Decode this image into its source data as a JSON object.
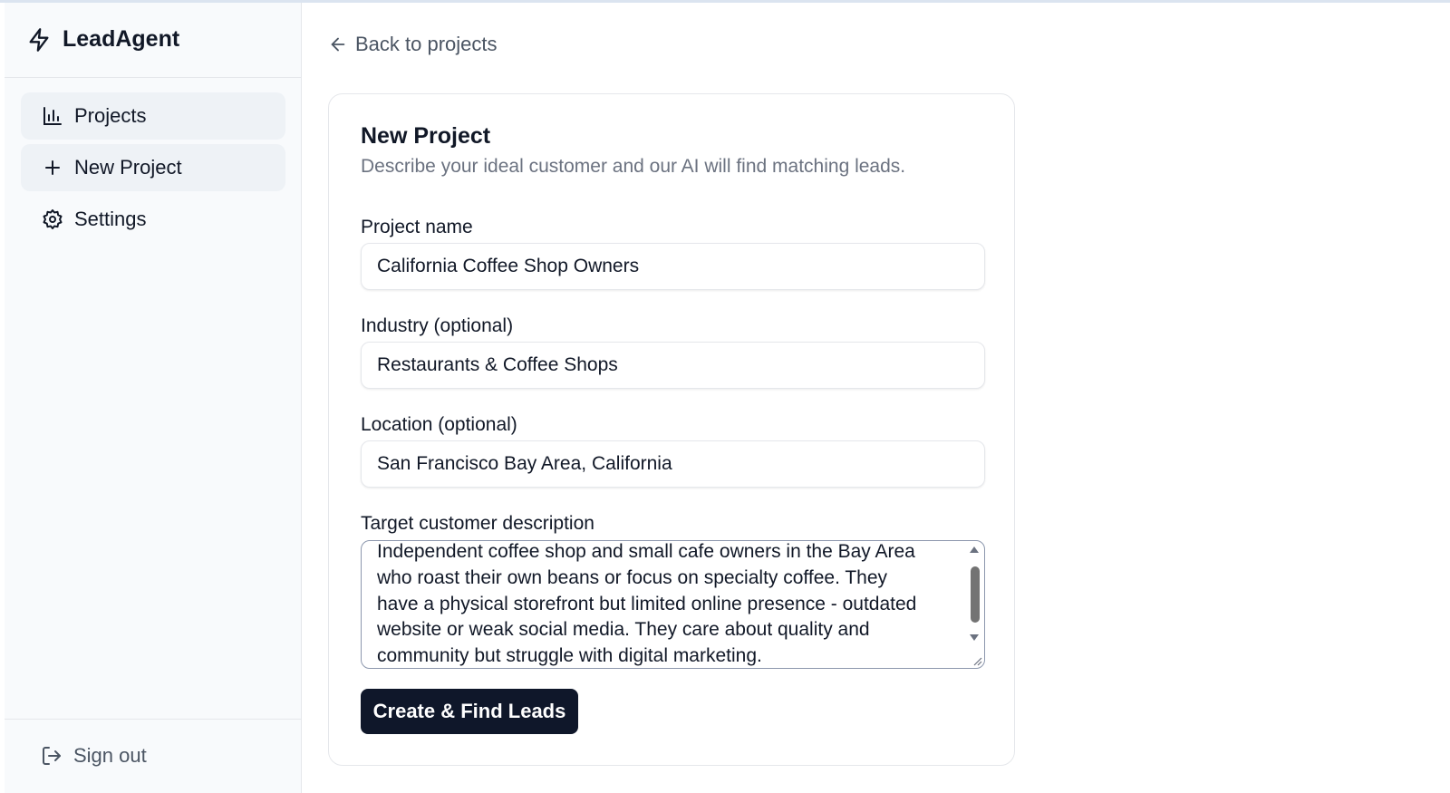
{
  "brand": {
    "name": "LeadAgent",
    "icon": "bolt-icon"
  },
  "sidebar": {
    "items": [
      {
        "label": "Projects",
        "icon": "bar-chart-icon",
        "active": true
      },
      {
        "label": "New Project",
        "icon": "plus-icon",
        "active": true
      },
      {
        "label": "Settings",
        "icon": "gear-icon",
        "active": false
      }
    ],
    "signout_label": "Sign out"
  },
  "main": {
    "back_label": "Back to projects",
    "card": {
      "title": "New Project",
      "subtitle": "Describe your ideal customer and our AI will find matching leads.",
      "fields": {
        "project_name": {
          "label": "Project name",
          "value": "California Coffee Shop Owners"
        },
        "industry": {
          "label": "Industry (optional)",
          "value": "Restaurants & Coffee Shops"
        },
        "location": {
          "label": "Location (optional)",
          "value": "San Francisco Bay Area, California"
        },
        "description": {
          "label": "Target customer description",
          "lines": [
            "Independent coffee shop and small cafe owners in the Bay Area",
            "who roast their own beans or focus on specialty coffee. They",
            "have a physical storefront but limited online presence - outdated",
            "website or weak social media. They care about quality and",
            "community but struggle with digital marketing."
          ]
        }
      },
      "submit_label": "Create & Find Leads"
    }
  },
  "colors": {
    "primary_button": "#0f172a",
    "sidebar_bg": "#f8fafc",
    "active_item_bg": "#eef2f6"
  }
}
